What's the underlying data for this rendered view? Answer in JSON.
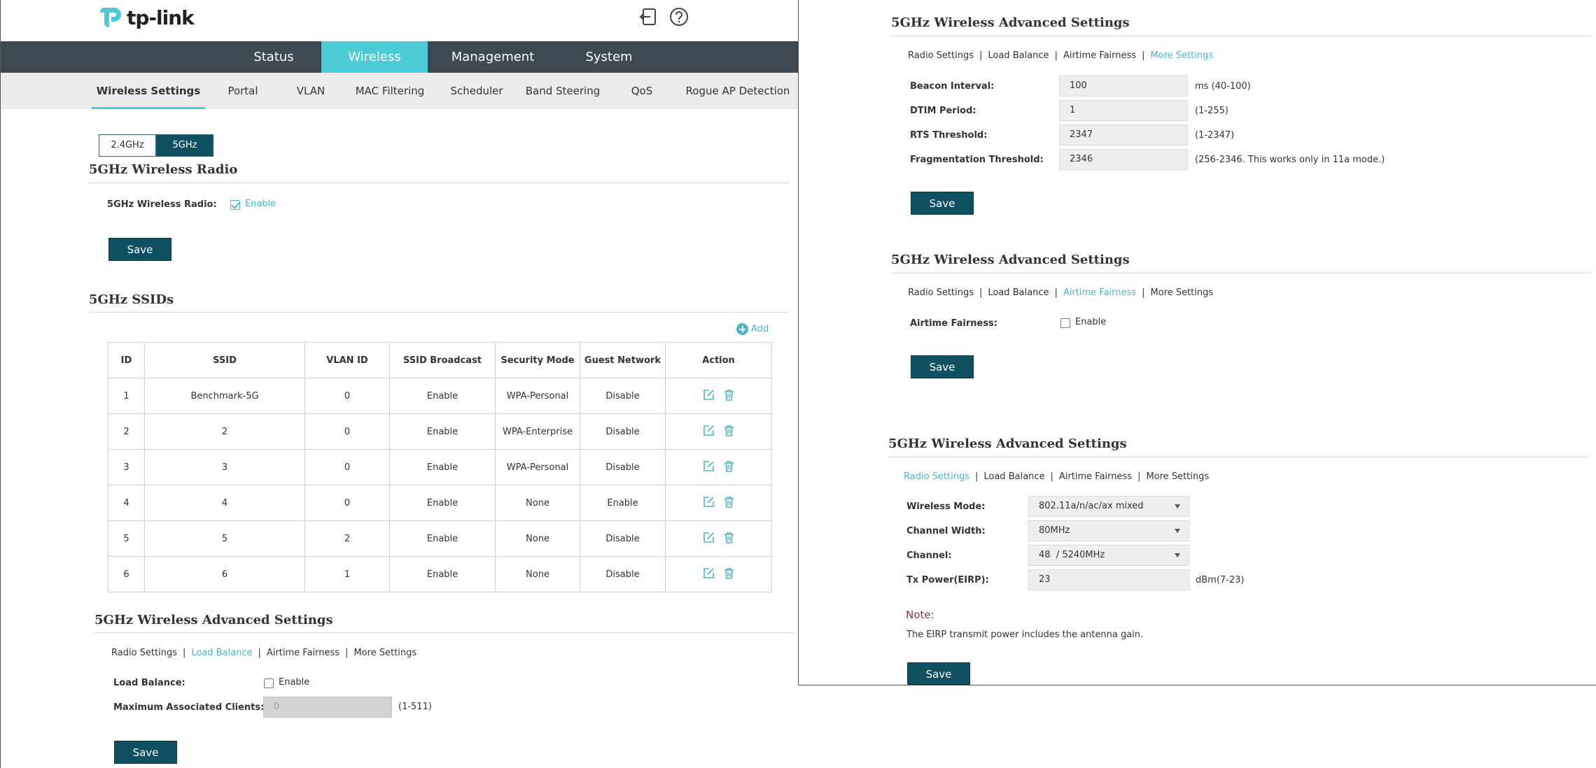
{
  "header": {
    "brand": "tp-link",
    "logout_icon": "logout-icon",
    "help_icon": "help-icon"
  },
  "nav": {
    "items": [
      {
        "label": "Status",
        "active": false
      },
      {
        "label": "Wireless",
        "active": true
      },
      {
        "label": "Management",
        "active": false
      },
      {
        "label": "System",
        "active": false
      }
    ]
  },
  "subnav": {
    "items": [
      {
        "label": "Wireless Settings",
        "active": true
      },
      {
        "label": "Portal",
        "active": false
      },
      {
        "label": "VLAN",
        "active": false
      },
      {
        "label": "MAC Filtering",
        "active": false
      },
      {
        "label": "Scheduler",
        "active": false
      },
      {
        "label": "Band Steering",
        "active": false
      },
      {
        "label": "QoS",
        "active": false
      },
      {
        "label": "Rogue AP Detection",
        "active": false
      }
    ]
  },
  "band": {
    "options": [
      "2.4GHz",
      "5GHz"
    ],
    "selected": "5GHz"
  },
  "radio_section": {
    "title": "5GHz Wireless Radio",
    "label": "5GHz Wireless Radio:",
    "enable_label": "Enable",
    "enabled": true,
    "save_label": "Save"
  },
  "ssids": {
    "title": "5GHz SSIDs",
    "add_label": "Add",
    "columns": [
      "ID",
      "SSID",
      "VLAN ID",
      "SSID Broadcast",
      "Security Mode",
      "Guest Network",
      "Action"
    ],
    "rows": [
      {
        "id": "1",
        "ssid": "Benchmark-5G",
        "vlan": "0",
        "broadcast": "Enable",
        "security": "WPA-Personal",
        "guest": "Disable"
      },
      {
        "id": "2",
        "ssid": "2",
        "vlan": "0",
        "broadcast": "Enable",
        "security": "WPA-Enterprise",
        "guest": "Disable"
      },
      {
        "id": "3",
        "ssid": "3",
        "vlan": "0",
        "broadcast": "Enable",
        "security": "WPA-Personal",
        "guest": "Disable"
      },
      {
        "id": "4",
        "ssid": "4",
        "vlan": "0",
        "broadcast": "Enable",
        "security": "None",
        "guest": "Enable"
      },
      {
        "id": "5",
        "ssid": "5",
        "vlan": "2",
        "broadcast": "Enable",
        "security": "None",
        "guest": "Disable"
      },
      {
        "id": "6",
        "ssid": "6",
        "vlan": "1",
        "broadcast": "Enable",
        "security": "None",
        "guest": "Disable"
      }
    ]
  },
  "advanced_tabs": [
    "Radio Settings",
    "Load Balance",
    "Airtime Fairness",
    "More Settings"
  ],
  "load_balance": {
    "title": "5GHz Wireless Advanced Settings",
    "active_tab": "Load Balance",
    "load_balance_label": "Load Balance:",
    "enable_label": "Enable",
    "enabled": false,
    "max_clients_label": "Maximum Associated Clients:",
    "max_clients_value": "0",
    "max_clients_range": "(1-511)",
    "save_label": "Save"
  },
  "more_settings": {
    "title": "5GHz Wireless Advanced Settings",
    "active_tab": "More Settings",
    "fields": [
      {
        "label": "Beacon Interval:",
        "value": "100",
        "hint": "ms (40-100)"
      },
      {
        "label": "DTIM Period:",
        "value": "1",
        "hint": "(1-255)"
      },
      {
        "label": "RTS Threshold:",
        "value": "2347",
        "hint": "(1-2347)"
      },
      {
        "label": "Fragmentation Threshold:",
        "value": "2346",
        "hint": "(256-2346. This works only in 11a mode.)"
      }
    ],
    "save_label": "Save"
  },
  "airtime": {
    "title": "5GHz Wireless Advanced Settings",
    "active_tab": "Airtime Fairness",
    "label": "Airtime Fairness:",
    "enable_label": "Enable",
    "enabled": false,
    "save_label": "Save"
  },
  "radio_settings": {
    "title": "5GHz Wireless Advanced Settings",
    "active_tab": "Radio Settings",
    "wireless_mode_label": "Wireless Mode:",
    "wireless_mode_value": "802.11a/n/ac/ax mixed",
    "channel_width_label": "Channel Width:",
    "channel_width_value": "80MHz",
    "channel_label": "Channel:",
    "channel_value": "48  / 5240MHz",
    "tx_power_label": "Tx Power(EIRP):",
    "tx_power_value": "23",
    "tx_power_hint": "dBm(7-23)",
    "note_title": "Note:",
    "note_text": "The EIRP transmit power includes the antenna gain.",
    "save_label": "Save"
  },
  "colors": {
    "accent": "#4acbd6",
    "link": "#4ab8c4",
    "nav_bg": "#3d4a52",
    "save_bg": "#0e5061",
    "note": "#8a3b4a"
  }
}
